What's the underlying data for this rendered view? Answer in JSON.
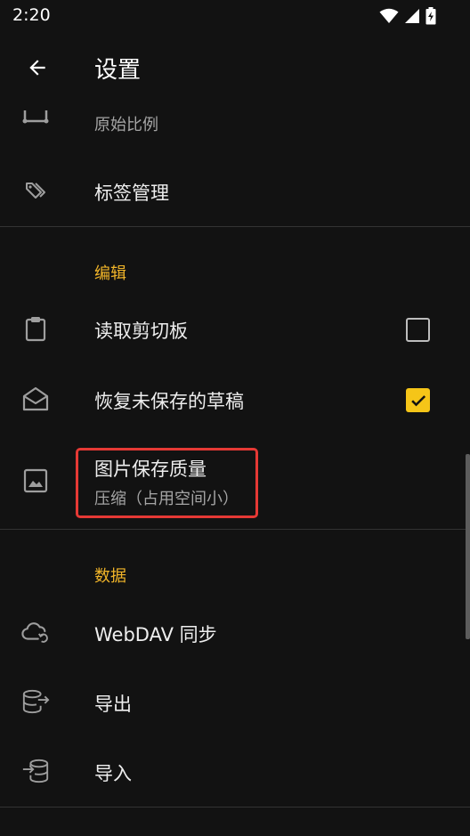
{
  "status_bar": {
    "time": "2:20"
  },
  "app_bar": {
    "title": "设置"
  },
  "items": {
    "aspect_ratio": {
      "subtitle": "原始比例"
    },
    "tag_management": {
      "title": "标签管理"
    },
    "read_clipboard": {
      "title": "读取剪切板",
      "checked": false
    },
    "restore_drafts": {
      "title": "恢复未保存的草稿",
      "checked": true
    },
    "image_quality": {
      "title": "图片保存质量",
      "subtitle": "压缩（占用空间小）"
    },
    "webdav_sync": {
      "title": "WebDAV 同步"
    },
    "export": {
      "title": "导出"
    },
    "import": {
      "title": "导入"
    }
  },
  "sections": {
    "edit": "编辑",
    "data": "数据"
  },
  "colors": {
    "background": "#121212",
    "accent": "#f0b429",
    "highlight": "#e53935"
  }
}
